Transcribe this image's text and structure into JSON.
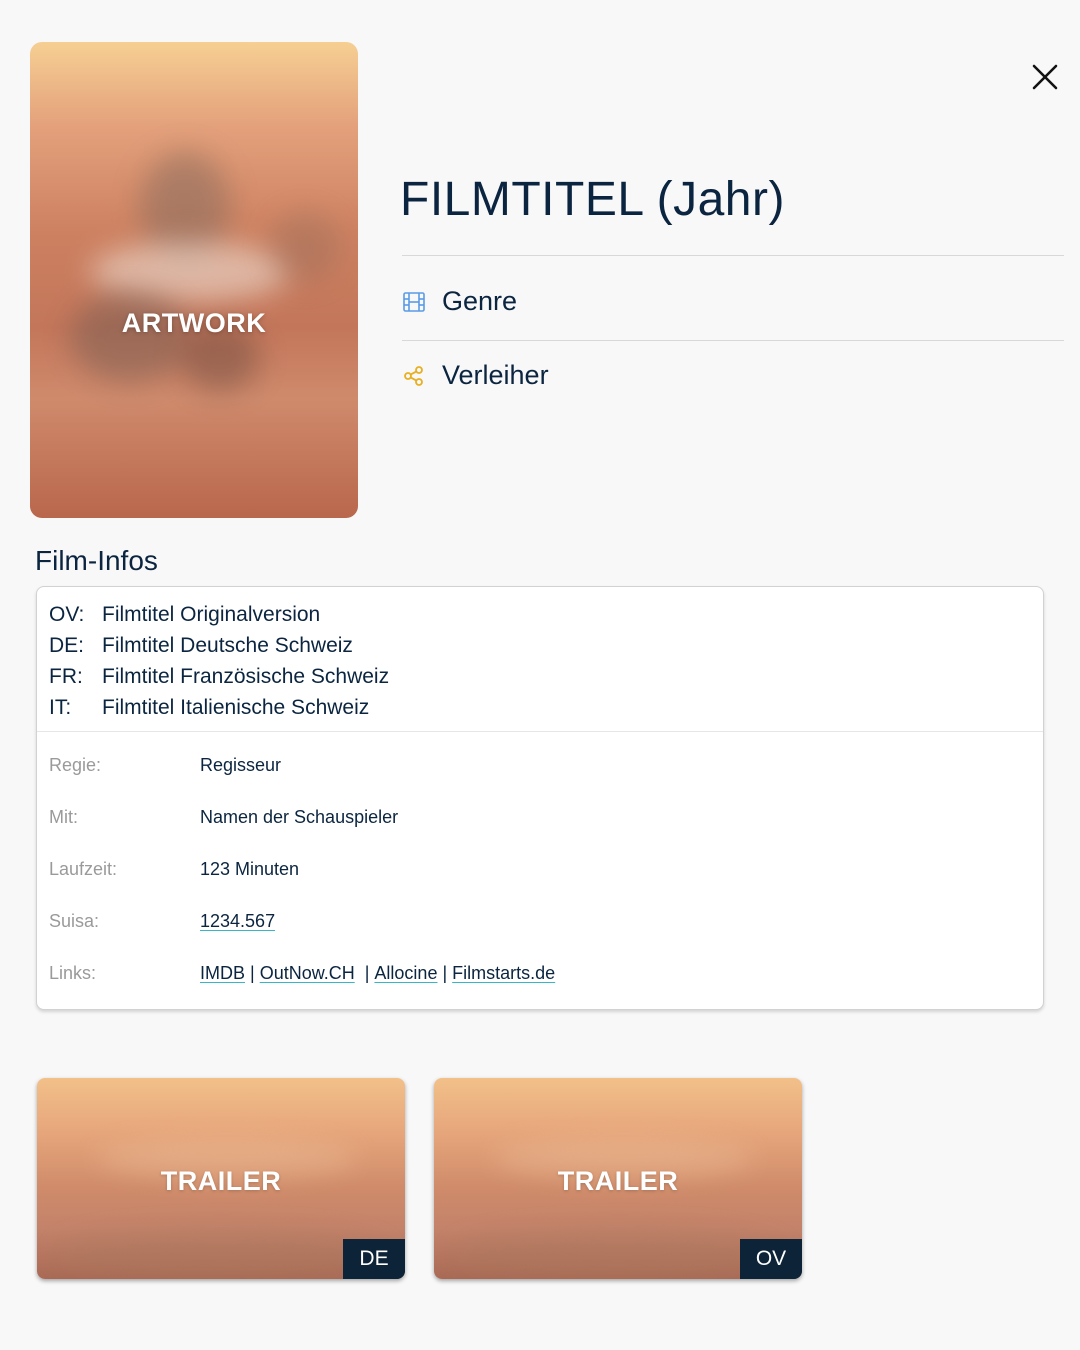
{
  "poster": {
    "label": "ARTWORK"
  },
  "header": {
    "title": "FILMTITEL (Jahr)",
    "genre": "Genre",
    "distributor": "Verleiher"
  },
  "colors": {
    "text": "#0b2540",
    "genre_icon": "#5a9be6",
    "distributor_icon": "#e8b020",
    "link_underline": "#38b6c8",
    "badge_bg": "#0c2338"
  },
  "icons": {
    "close": "close-icon",
    "genre": "film-icon",
    "distributor": "share-icon"
  },
  "film_infos": {
    "heading": "Film-Infos",
    "titles": [
      {
        "key": "OV:",
        "value": "Filmtitel Originalversion"
      },
      {
        "key": "DE:",
        "value": "Filmtitel Deutsche Schweiz"
      },
      {
        "key": "FR:",
        "value": "Filmtitel Französische Schweiz"
      },
      {
        "key": "IT:",
        "value": "Filmtitel Italienische Schweiz"
      }
    ],
    "details": {
      "director_label": "Regie:",
      "director": "Regisseur",
      "cast_label": "Mit:",
      "cast": "Namen der Schauspieler",
      "runtime_label": "Laufzeit:",
      "runtime": "123 Minuten",
      "suisa_label": "Suisa:",
      "suisa": "1234.567",
      "links_label": "Links:",
      "links": [
        "IMDB",
        "OutNow.CH",
        "Allocine",
        "Filmstarts.de"
      ],
      "link_separator": "|"
    }
  },
  "trailers": [
    {
      "label": "TRAILER",
      "badge": "DE"
    },
    {
      "label": "TRAILER",
      "badge": "OV"
    }
  ]
}
